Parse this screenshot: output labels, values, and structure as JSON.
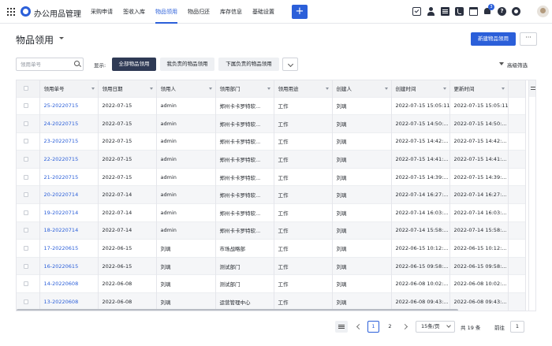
{
  "app": {
    "title": "办公用品管理"
  },
  "nav": {
    "items": [
      {
        "label": "采购申请",
        "active": false
      },
      {
        "label": "签收入库",
        "active": false
      },
      {
        "label": "物品领用",
        "active": true
      },
      {
        "label": "物品归还",
        "active": false
      },
      {
        "label": "库存信息",
        "active": false
      },
      {
        "label": "基础设置",
        "active": false
      }
    ],
    "plus_label": "+",
    "notification_count": "3",
    "help_label": "?"
  },
  "page": {
    "title": "物品领用",
    "new_button": "新建物品领用",
    "more_button": "···"
  },
  "filter": {
    "search_placeholder": "领用单号",
    "show_label": "显示:",
    "segments": [
      "全部物品领用",
      "我负责的物品领用",
      "下属负责的物品领用"
    ],
    "active_segment": 0,
    "advanced_filter": "高级筛选"
  },
  "table": {
    "columns": [
      "领用单号",
      "领用日期",
      "领用人",
      "领用部门",
      "领用用途",
      "创建人",
      "创建时间",
      "更新时间"
    ],
    "rows": [
      [
        "25-20220715",
        "2022-07-15",
        "admin",
        "郑州卡卡罗特软...",
        "工作",
        "刘璃",
        "2022-07-15 15:05:11",
        "2022-07-15 15:05:11"
      ],
      [
        "24-20220715",
        "2022-07-15",
        "admin",
        "郑州卡卡罗特软...",
        "工作",
        "刘璃",
        "2022-07-15 14:50:...",
        "2022-07-15 14:50:..."
      ],
      [
        "23-20220715",
        "2022-07-15",
        "admin",
        "郑州卡卡罗特软...",
        "工作",
        "刘璃",
        "2022-07-15 14:42:...",
        "2022-07-15 14:42:..."
      ],
      [
        "22-20220715",
        "2022-07-15",
        "admin",
        "郑州卡卡罗特软...",
        "工作",
        "刘璃",
        "2022-07-15 14:41:...",
        "2022-07-15 14:41:..."
      ],
      [
        "21-20220715",
        "2022-07-15",
        "admin",
        "郑州卡卡罗特软...",
        "工作",
        "刘璃",
        "2022-07-15 14:39:...",
        "2022-07-15 14:39:..."
      ],
      [
        "20-20220714",
        "2022-07-14",
        "admin",
        "郑州卡卡罗特软...",
        "工作",
        "刘璃",
        "2022-07-14 16:27:...",
        "2022-07-14 16:27:..."
      ],
      [
        "19-20220714",
        "2022-07-14",
        "admin",
        "郑州卡卡罗特软...",
        "工作",
        "刘璃",
        "2022-07-14 16:03:...",
        "2022-07-14 16:03:..."
      ],
      [
        "18-20220714",
        "2022-07-14",
        "admin",
        "郑州卡卡罗特软...",
        "工作",
        "刘璃",
        "2022-07-14 15:58:...",
        "2022-07-14 15:58:..."
      ],
      [
        "17-20220615",
        "2022-06-15",
        "刘璃",
        "市场战略部",
        "工作",
        "刘璃",
        "2022-06-15 10:12:...",
        "2022-06-15 10:12:..."
      ],
      [
        "16-20220615",
        "2022-06-15",
        "刘璃",
        "测试部门",
        "工作",
        "刘璃",
        "2022-06-15 09:58:...",
        "2022-06-15 09:58:..."
      ],
      [
        "14-20220608",
        "2022-06-08",
        "刘璃",
        "测试部门",
        "工作",
        "刘璃",
        "2022-06-08 10:02:...",
        "2022-06-08 10:02:..."
      ],
      [
        "13-20220608",
        "2022-06-08",
        "刘璃",
        "运营管理中心",
        "工作",
        "刘璃",
        "2022-06-08 09:43:...",
        "2022-06-08 09:43:..."
      ]
    ]
  },
  "pagination": {
    "pages": [
      "1",
      "2"
    ],
    "current_page": "1",
    "page_size": "15条/页",
    "total": "共 19 条",
    "goto_label": "前往",
    "goto_value": "1"
  },
  "colors": {
    "accent": "#2b5fd9",
    "segment_active": "#2f3a55",
    "link": "#2b5fd9"
  }
}
